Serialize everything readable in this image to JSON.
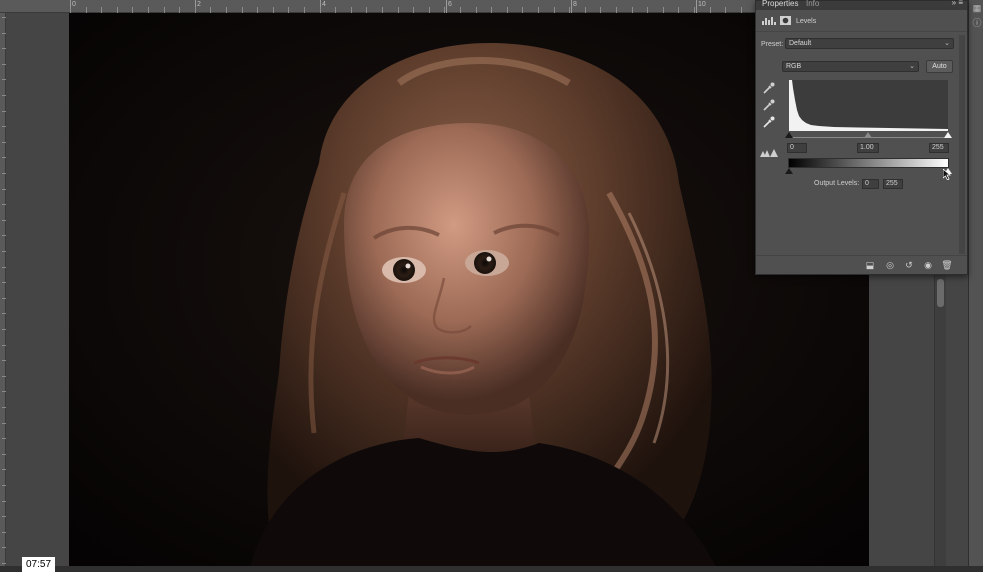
{
  "ruler": {
    "labels": [
      "0",
      "2",
      "4",
      "6",
      "8",
      "10"
    ]
  },
  "panel": {
    "tabs": [
      "Properties",
      "Info"
    ],
    "menu_icon": "double-chevron-menu-icon",
    "title": "Levels",
    "preset_label": "Preset:",
    "preset_value": "Default",
    "channel_value": "RGB",
    "auto_label": "Auto",
    "input_black": "0",
    "input_gamma": "1.00",
    "input_white": "255",
    "output_label": "Output Levels:",
    "output_black": "0",
    "output_white": "255",
    "footer_icons": [
      "clip-to-layer-icon",
      "view-previous-icon",
      "reset-icon",
      "visibility-eye-icon",
      "trash-icon"
    ]
  },
  "timestamp": "07:57"
}
